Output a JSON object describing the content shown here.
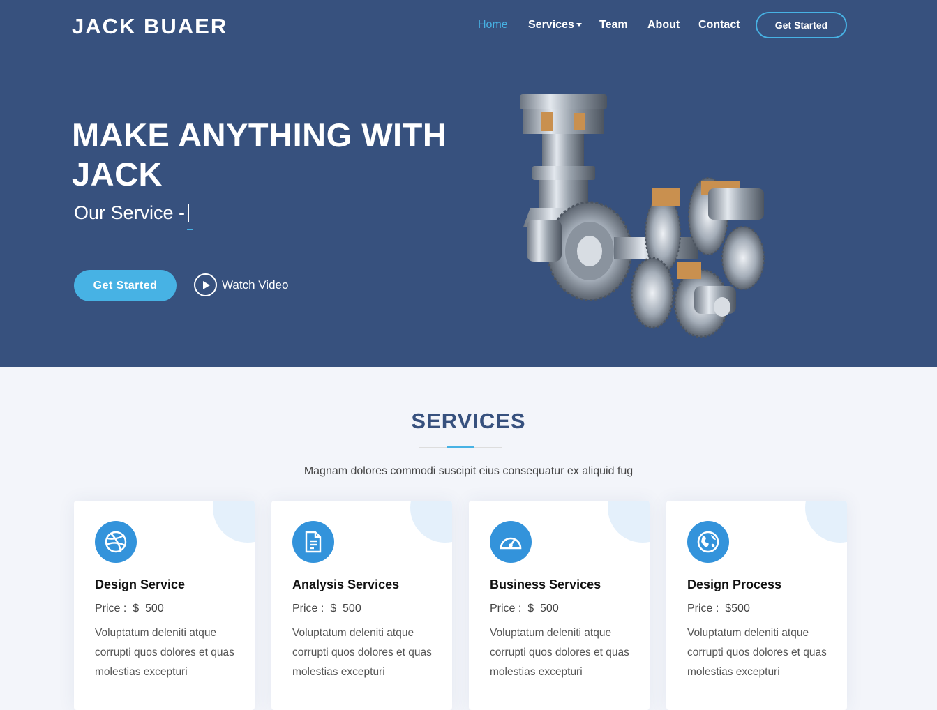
{
  "header": {
    "logo": "JACK BUAER",
    "nav": [
      {
        "label": "Home"
      },
      {
        "label": "Services"
      },
      {
        "label": "Team"
      },
      {
        "label": "About"
      },
      {
        "label": "Contact"
      }
    ],
    "cta": "Get Started"
  },
  "hero": {
    "title": "MAKE ANYTHING WITH JACK",
    "subtitle": "Our Service -",
    "button": "Get Started",
    "watch": "Watch Video"
  },
  "services": {
    "title": "SERVICES",
    "description": "Magnam dolores commodi suscipit eius consequatur ex aliquid fug",
    "cards": [
      {
        "title": "Design Service",
        "price_label": "Price :",
        "currency": "$",
        "price": "500",
        "text": "Voluptatum deleniti atque corrupti quos dolores et quas molestias excepturi",
        "icon": "dribbble-icon"
      },
      {
        "title": "Analysis Services",
        "price_label": "Price :",
        "currency": "$",
        "price": "500",
        "text": "Voluptatum deleniti atque corrupti quos dolores et quas molestias excepturi",
        "icon": "file-icon"
      },
      {
        "title": "Business Services",
        "price_label": "Price :",
        "currency": "$",
        "price": "500",
        "text": "Voluptatum deleniti atque corrupti quos dolores et quas molestias excepturi",
        "icon": "speedometer-icon"
      },
      {
        "title": "Design Process",
        "price_label": "Price :",
        "currency": "$",
        "price": "500",
        "text": "Voluptatum deleniti atque corrupti quos dolores et quas molestias excepturi",
        "icon": "globe-icon"
      }
    ]
  },
  "colors": {
    "hero_bg": "#37517e",
    "accent": "#47b2e4",
    "icon_bg": "#3393db",
    "page_bg": "#f3f5fa"
  }
}
